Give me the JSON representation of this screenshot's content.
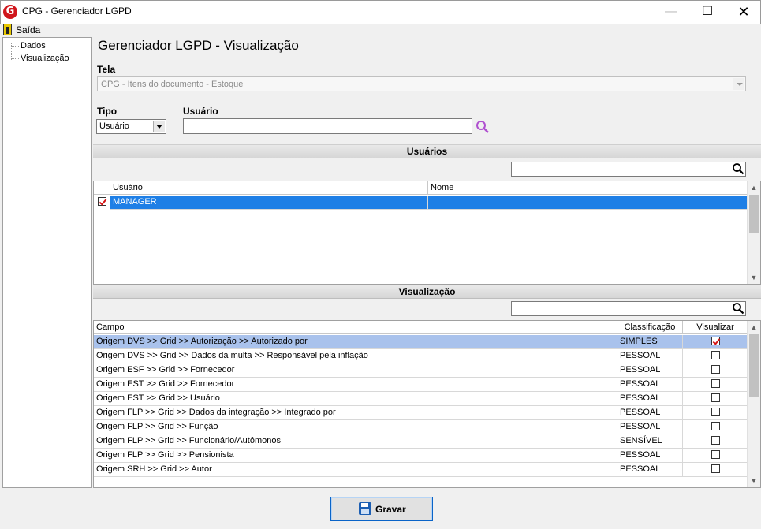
{
  "window": {
    "logo_letter": "G",
    "title": "CPG - Gerenciador LGPD",
    "minimize_glyph": "—",
    "maximize_glyph": "☐",
    "close_glyph": "✕"
  },
  "menu": {
    "exit_label": "Saída"
  },
  "tree": {
    "items": [
      "Dados",
      "Visualização"
    ]
  },
  "page": {
    "title": "Gerenciador LGPD - Visualização"
  },
  "form": {
    "tela_label": "Tela",
    "tela_value": "CPG - Itens do documento - Estoque",
    "tipo_label": "Tipo",
    "tipo_value": "Usuário",
    "usuario_label": "Usuário",
    "usuario_value": ""
  },
  "users_section": {
    "header": "Usuários",
    "search_value": "",
    "columns": [
      "Usuário",
      "Nome"
    ],
    "rows": [
      {
        "checked": true,
        "usuario": "MANAGER",
        "nome": ""
      }
    ]
  },
  "view_section": {
    "header": "Visualização",
    "search_value": "",
    "columns": [
      "Campo",
      "Classificação",
      "Visualizar"
    ],
    "rows": [
      {
        "campo": "Origem DVS >> Grid >> Autorização >> Autorizado por",
        "classificacao": "SIMPLES",
        "visualizar": true
      },
      {
        "campo": "Origem DVS >> Grid >> Dados da multa >> Responsável pela inflação",
        "classificacao": "PESSOAL",
        "visualizar": false
      },
      {
        "campo": "Origem ESF >> Grid >> Fornecedor",
        "classificacao": "PESSOAL",
        "visualizar": false
      },
      {
        "campo": "Origem EST >> Grid >> Fornecedor",
        "classificacao": "PESSOAL",
        "visualizar": false
      },
      {
        "campo": "Origem EST >> Grid >> Usuário",
        "classificacao": "PESSOAL",
        "visualizar": false
      },
      {
        "campo": "Origem FLP >> Grid >> Dados da integração >> Integrado por",
        "classificacao": "PESSOAL",
        "visualizar": false
      },
      {
        "campo": "Origem FLP >> Grid >> Função",
        "classificacao": "PESSOAL",
        "visualizar": false
      },
      {
        "campo": "Origem FLP >> Grid >> Funcionário/Autômonos",
        "classificacao": "SENSÍVEL",
        "visualizar": false
      },
      {
        "campo": "Origem FLP >> Grid >> Pensionista",
        "classificacao": "PESSOAL",
        "visualizar": false
      },
      {
        "campo": "Origem SRH >> Grid >> Autor",
        "classificacao": "PESSOAL",
        "visualizar": false
      }
    ]
  },
  "footer": {
    "save_label": "Gravar"
  },
  "colors": {
    "selection_blue": "#1e7fe6",
    "selection_light": "#a9c2ec",
    "check_red": "#d41414",
    "search_purple": "#b050d0"
  }
}
